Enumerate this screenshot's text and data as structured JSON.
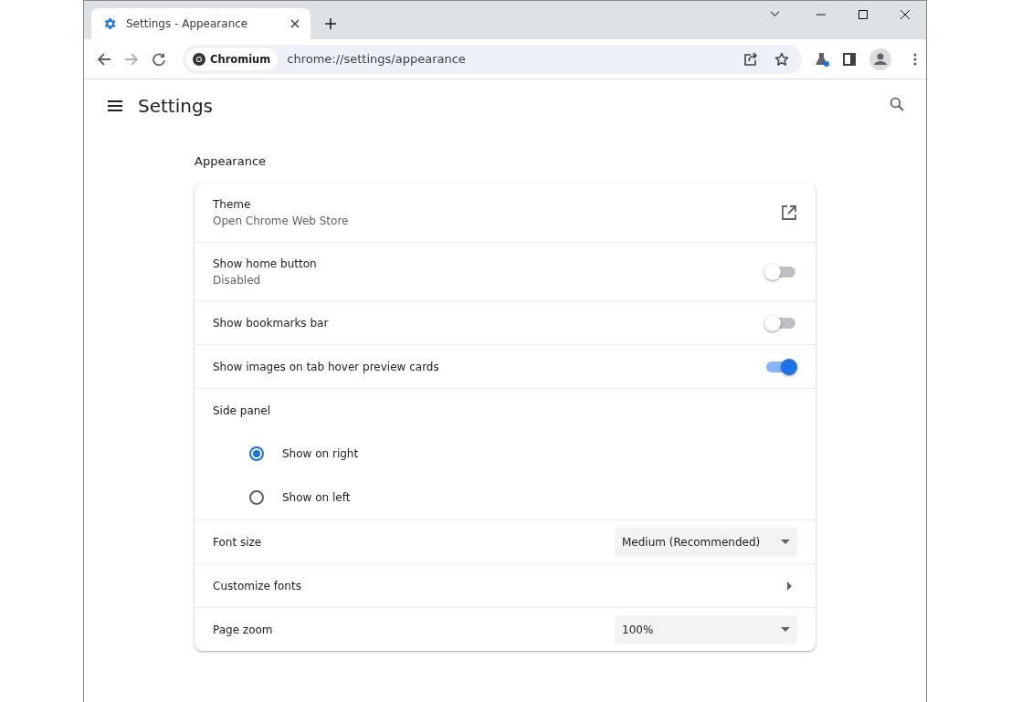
{
  "window": {
    "tab": {
      "title": "Settings - Appearance",
      "selected": true
    },
    "address": {
      "chip": "Chromium",
      "url": "chrome://settings/appearance"
    }
  },
  "header": {
    "title": "Settings"
  },
  "section": {
    "title": "Appearance",
    "rows": [
      {
        "kind": "link",
        "label": "Theme",
        "sublabel": "Open Chrome Web Store"
      },
      {
        "kind": "toggle",
        "label": "Show home button",
        "sublabel": "Disabled",
        "on": false
      },
      {
        "kind": "toggle",
        "label": "Show bookmarks bar",
        "on": false
      },
      {
        "kind": "toggle",
        "label": "Show images on tab hover preview cards",
        "on": true
      },
      {
        "kind": "radio-group",
        "label": "Side panel",
        "options": [
          {
            "label": "Show on right",
            "selected": true
          },
          {
            "label": "Show on left",
            "selected": false
          }
        ]
      },
      {
        "kind": "dropdown",
        "label": "Font size",
        "value": "Medium (Recommended)"
      },
      {
        "kind": "submenu",
        "label": "Customize fonts"
      },
      {
        "kind": "dropdown",
        "label": "Page zoom",
        "value": "100%"
      }
    ]
  }
}
